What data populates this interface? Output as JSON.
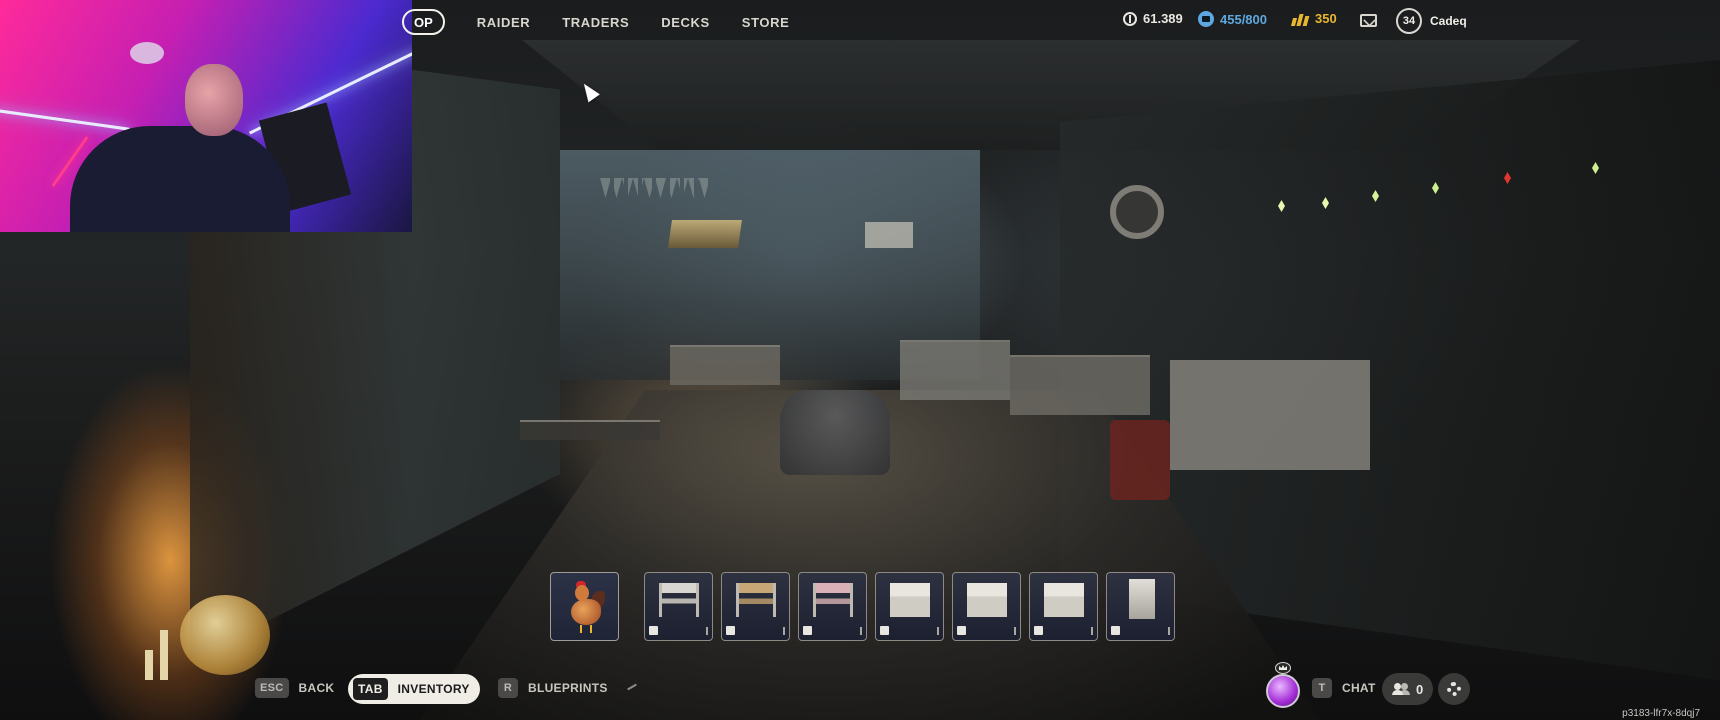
{
  "nav": {
    "active_tab_partial": "OP",
    "tabs": [
      "RAIDER",
      "TRADERS",
      "DECKS",
      "STORE"
    ]
  },
  "currencies": {
    "coins": "61.389",
    "stash": "455/800",
    "premium": "350"
  },
  "profile": {
    "level": "34",
    "username": "Cadeq"
  },
  "hotbar": {
    "slots": [
      {
        "icon": "chicken-icon"
      },
      {
        "icon": "workbench-icon",
        "category_icon": "bench-icon"
      },
      {
        "icon": "workbench-icon",
        "category_icon": "tools-icon"
      },
      {
        "icon": "workbench-icon",
        "category_icon": "explosive-icon"
      },
      {
        "icon": "workbench-icon",
        "category_icon": "shield-icon"
      },
      {
        "icon": "workbench-icon",
        "category_icon": "crossed-tools-icon"
      },
      {
        "icon": "workbench-icon",
        "category_icon": "medical-icon"
      },
      {
        "icon": "workbench-icon",
        "category_icon": "utility-icon"
      }
    ]
  },
  "bottom": {
    "back_key": "ESC",
    "back_label": "BACK",
    "inventory_key": "TAB",
    "inventory_label": "INVENTORY",
    "blueprints_key": "R",
    "blueprints_label": "BLUEPRINTS",
    "chat_key": "T",
    "chat_label": "CHAT",
    "friends_count": "0",
    "session_id": "p3183-lfr7x-8dqj7"
  },
  "colors": {
    "slots_blue": "#5fa8df",
    "premium_gold": "#e8b72e",
    "inventory_pill": "#efede6"
  }
}
